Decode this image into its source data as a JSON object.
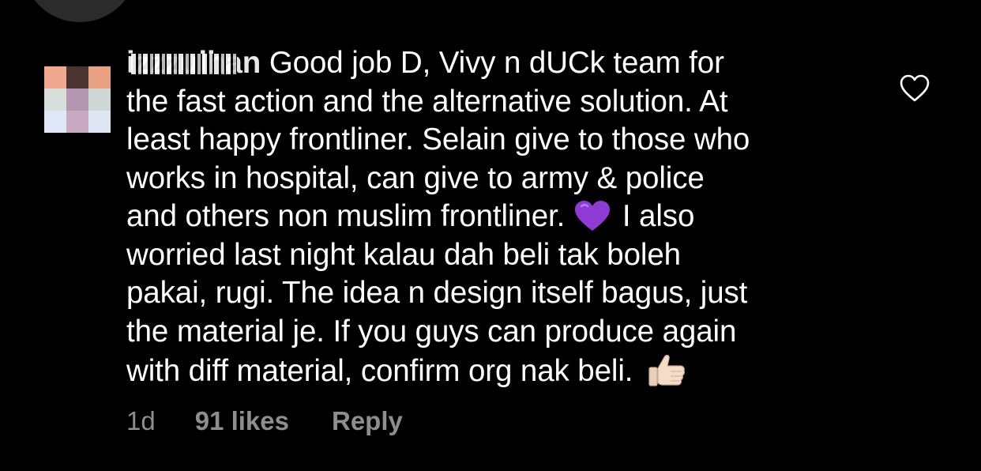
{
  "comment": {
    "username": "izzzulhan",
    "lines": [
      "Good job D, Vivy n dUCk team for",
      "the fast action and the alternative solution. At",
      "least happy frontliner. Selain give to those who",
      "works in hospital, can give to army & police",
      "and others non muslim frontliner.",
      "I also",
      "worried last night kalau dah beli tak boleh",
      "pakai, rugi. The idea n design itself bagus, just",
      "the material je. If you guys can produce again",
      "with diff material, confirm org nak beli."
    ],
    "emojis": {
      "heart": "purple-heart-emoji",
      "thumb": "thumbs-up-emoji"
    }
  },
  "meta": {
    "time": "1d",
    "likes": "91 likes",
    "reply": "Reply"
  },
  "icons": {
    "like": "heart-outline-icon",
    "avatar": "blurred-avatar"
  },
  "colors": {
    "background": "#000000",
    "text": "#ffffff",
    "meta": "#8e8e8e",
    "heart_emoji": "#8e3bd6"
  }
}
